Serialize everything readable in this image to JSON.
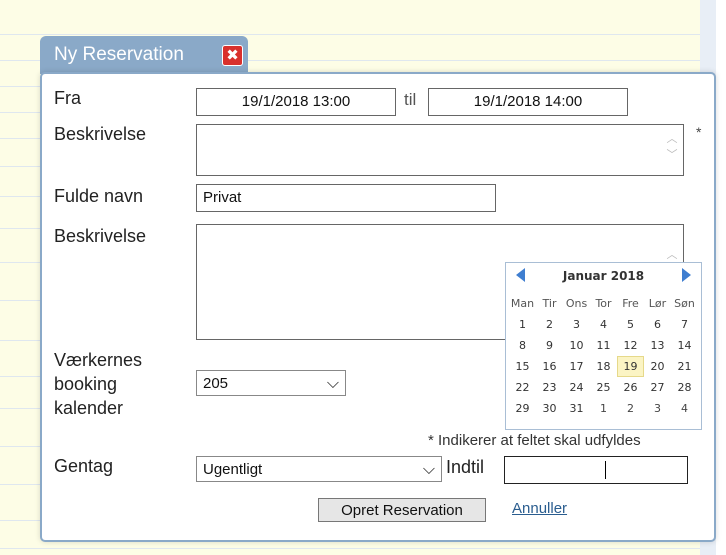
{
  "dialog": {
    "title": "Ny Reservation",
    "close_glyph": "✖"
  },
  "form": {
    "fra_label": "Fra",
    "fra_from": "19/1/2018  13:00",
    "til_label": "til",
    "fra_to": "19/1/2018  14:00",
    "beskrivelse1_label": "Beskrivelse",
    "beskrivelse1_value": "",
    "required_mark": "*",
    "fulde_navn_label": "Fulde navn",
    "fulde_navn_value": "Privat",
    "beskrivelse2_label": "Beskrivelse",
    "beskrivelse2_value": "",
    "kalender_label_1": "Værkernes",
    "kalender_label_2": "booking",
    "kalender_label_3": "kalender",
    "kalender_value": "205",
    "required_note": "* Indikerer at feltet skal udfyldes",
    "gentag_label": "Gentag",
    "gentag_value": "Ugentligt",
    "indtil_label": "Indtil",
    "indtil_value": ""
  },
  "calendar": {
    "title": "Januar 2018",
    "weekdays": [
      "Man",
      "Tir",
      "Ons",
      "Tor",
      "Fre",
      "Lør",
      "Søn"
    ],
    "weeks": [
      [
        "1",
        "2",
        "3",
        "4",
        "5",
        "6",
        "7"
      ],
      [
        "8",
        "9",
        "10",
        "11",
        "12",
        "13",
        "14"
      ],
      [
        "15",
        "16",
        "17",
        "18",
        "19",
        "20",
        "21"
      ],
      [
        "22",
        "23",
        "24",
        "25",
        "26",
        "27",
        "28"
      ],
      [
        "29",
        "30",
        "31",
        "1",
        "2",
        "3",
        "4"
      ]
    ],
    "selected": "19"
  },
  "actions": {
    "submit_label": "Opret Reservation",
    "cancel_label": "Annuller"
  },
  "colors": {
    "dialog_border": "#8aa9c8",
    "close_red": "#d9302c",
    "nav_arrow": "#3f7ed0",
    "today_highlight": "#fbf4c4"
  }
}
